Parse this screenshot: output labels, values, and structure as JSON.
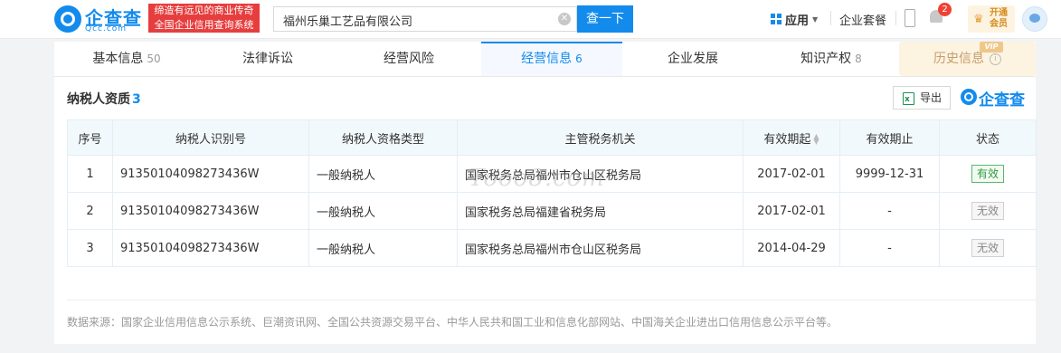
{
  "header": {
    "logo_text": "企查查",
    "logo_sub": "Qcc.com",
    "slogan_line1": "缔造有远见的商业传奇",
    "slogan_line2": "全国企业信用查询系统",
    "search_value": "福州乐巢工艺品有限公司",
    "search_button": "查一下",
    "app_menu": "应用",
    "package_link": "企业套餐",
    "notification_count": "2",
    "vip_line1": "开通",
    "vip_line2": "会员"
  },
  "tabs": [
    {
      "label": "基本信息",
      "count": "50"
    },
    {
      "label": "法律诉讼",
      "count": ""
    },
    {
      "label": "经营风险",
      "count": ""
    },
    {
      "label": "经营信息",
      "count": "6"
    },
    {
      "label": "企业发展",
      "count": ""
    },
    {
      "label": "知识产权",
      "count": "8"
    },
    {
      "label": "历史信息",
      "count": ""
    }
  ],
  "vip_tag": "VIP",
  "section": {
    "title": "纳税人资质",
    "count": "3",
    "export_label": "导出",
    "brand": "企查查"
  },
  "table": {
    "headers": [
      "序号",
      "纳税人识别号",
      "纳税人资格类型",
      "主管税务机关",
      "有效期起",
      "有效期止",
      "状态"
    ],
    "rows": [
      {
        "no": "1",
        "id": "91350104098273436W",
        "type": "一般纳税人",
        "authority": "国家税务总局福州市仓山区税务局",
        "start": "2017-02-01",
        "end": "9999-12-31",
        "status": "有效"
      },
      {
        "no": "2",
        "id": "91350104098273436W",
        "type": "一般纳税人",
        "authority": "国家税务总局福建省税务局",
        "start": "2017-02-01",
        "end": "-",
        "status": "无效"
      },
      {
        "no": "3",
        "id": "91350104098273436W",
        "type": "一般纳税人",
        "authority": "国家税务总局福州市仓山区税务局",
        "start": "2014-04-29",
        "end": "-",
        "status": "无效"
      }
    ]
  },
  "watermark": "Tooo8.com",
  "source_note": "数据来源：国家企业信用信息公示系统、巨潮资讯网、全国公共资源交易平台、中华人民共和国工业和信息化部网站、中国海关企业进出口信用信息公示平台等。",
  "colors": {
    "accent": "#128bed",
    "valid": "#2f9a41",
    "slogan_bg": "#e63e3e"
  }
}
